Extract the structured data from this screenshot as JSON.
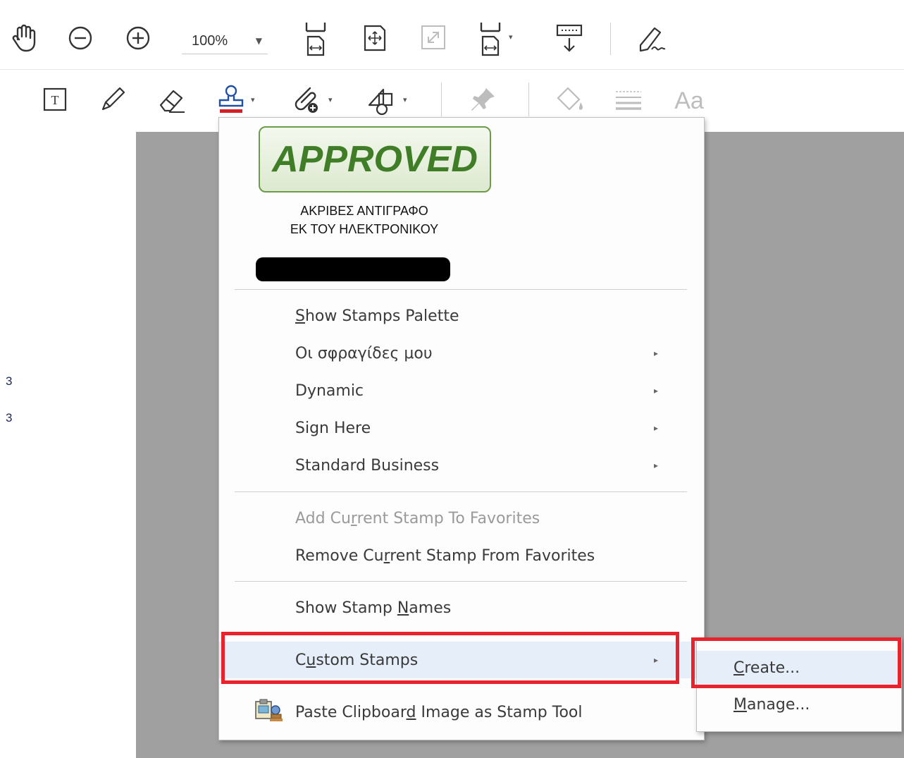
{
  "toolbar_top": {
    "zoom_value": "100%",
    "icons": [
      "hand-icon",
      "zoom-out-icon",
      "zoom-in-icon",
      "fit-page-icon",
      "fit-width-icon",
      "full-screen-icon",
      "page-layout-icon",
      "read-mode-icon",
      "sign-icon"
    ]
  },
  "toolbar_comment": {
    "icons": [
      "text-box-icon",
      "pencil-icon",
      "eraser-icon",
      "stamp-icon",
      "attach-icon",
      "shapes-icon",
      "pin-icon",
      "fill-icon",
      "lines-icon"
    ],
    "font_label": "Aa"
  },
  "left_marks": [
    "3",
    "3"
  ],
  "stamp_menu": {
    "approved_stamp": "APPROVED",
    "custom_stamp_line1": "ΑΚΡΙΒΕΣ ΑΝΤΙΓΡΑΦΟ",
    "custom_stamp_line2": "ΕΚ ΤΟΥ ΗΛΕΚΤΡΟΝΙΚΟΥ",
    "items": {
      "show_palette": {
        "pre": "",
        "u": "S",
        "post": "how Stamps Palette"
      },
      "my_stamps": "Οι σφραγίδες μου",
      "dynamic": "Dynamic",
      "sign_here": "Sign Here",
      "standard_business": "Standard Business",
      "add_fav": {
        "pre": "Add Cu",
        "u": "r",
        "post": "rent Stamp To Favorites"
      },
      "remove_fav": {
        "pre": "Remove Cu",
        "u": "r",
        "post": "rent Stamp From Favorites"
      },
      "show_names": {
        "pre": "Show Stamp ",
        "u": "N",
        "post": "ames"
      },
      "custom_stamps": {
        "pre": "C",
        "u": "u",
        "post": "stom Stamps"
      },
      "paste_clipboard": {
        "pre": "Paste Clipboar",
        "u": "d",
        "post": " Image as Stamp Tool"
      }
    },
    "submenu_arrow": "▸"
  },
  "custom_submenu": {
    "create": {
      "u": "C",
      "post": "reate..."
    },
    "manage": {
      "u": "M",
      "post": "anage..."
    }
  },
  "colors": {
    "highlight_border": "#e8232e",
    "approved_green": "#3f7d27",
    "doc_bg": "#a0a0a0"
  }
}
